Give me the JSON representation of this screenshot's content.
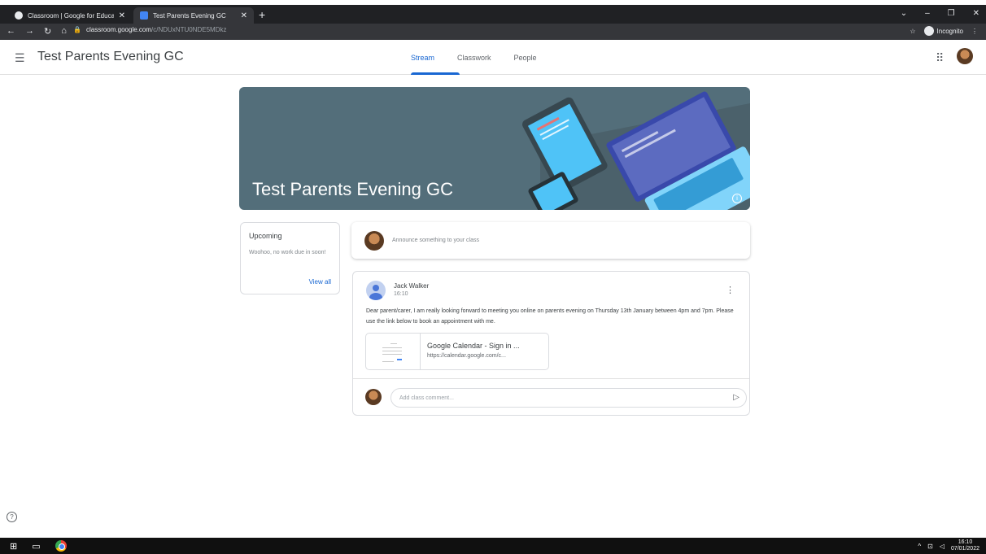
{
  "browser": {
    "tabs": [
      {
        "title": "Classroom | Google for Education"
      },
      {
        "title": "Test Parents Evening GC"
      }
    ],
    "url_host": "classroom.google.com",
    "url_path": "/c/NDUxNTU0NDE5MDkz",
    "incognito_label": "Incognito"
  },
  "header": {
    "class_name": "Test Parents Evening GC",
    "tabs": [
      {
        "label": "Stream"
      },
      {
        "label": "Classwork"
      },
      {
        "label": "People"
      }
    ]
  },
  "banner": {
    "title": "Test Parents Evening GC"
  },
  "upcoming": {
    "title": "Upcoming",
    "text": "Woohoo, no work due in soon!",
    "link": "View all"
  },
  "announce": {
    "placeholder": "Announce something to your class"
  },
  "post": {
    "author": "Jack Walker",
    "time": "16:10",
    "body": "Dear parent/carer, I am really looking forward to meeting you online on parents evening on Thursday 13th January between 4pm and 7pm. Please use the link below to book an appointment with me.",
    "attachment": {
      "title": "Google Calendar - Sign in ...",
      "url": "https://calendar.google.com/c..."
    },
    "comment_placeholder": "Add class comment..."
  },
  "taskbar": {
    "time": "16:10",
    "date": "07/01/2022"
  },
  "colors": {
    "accent": "#1967d2",
    "banner": "#536e7a"
  }
}
